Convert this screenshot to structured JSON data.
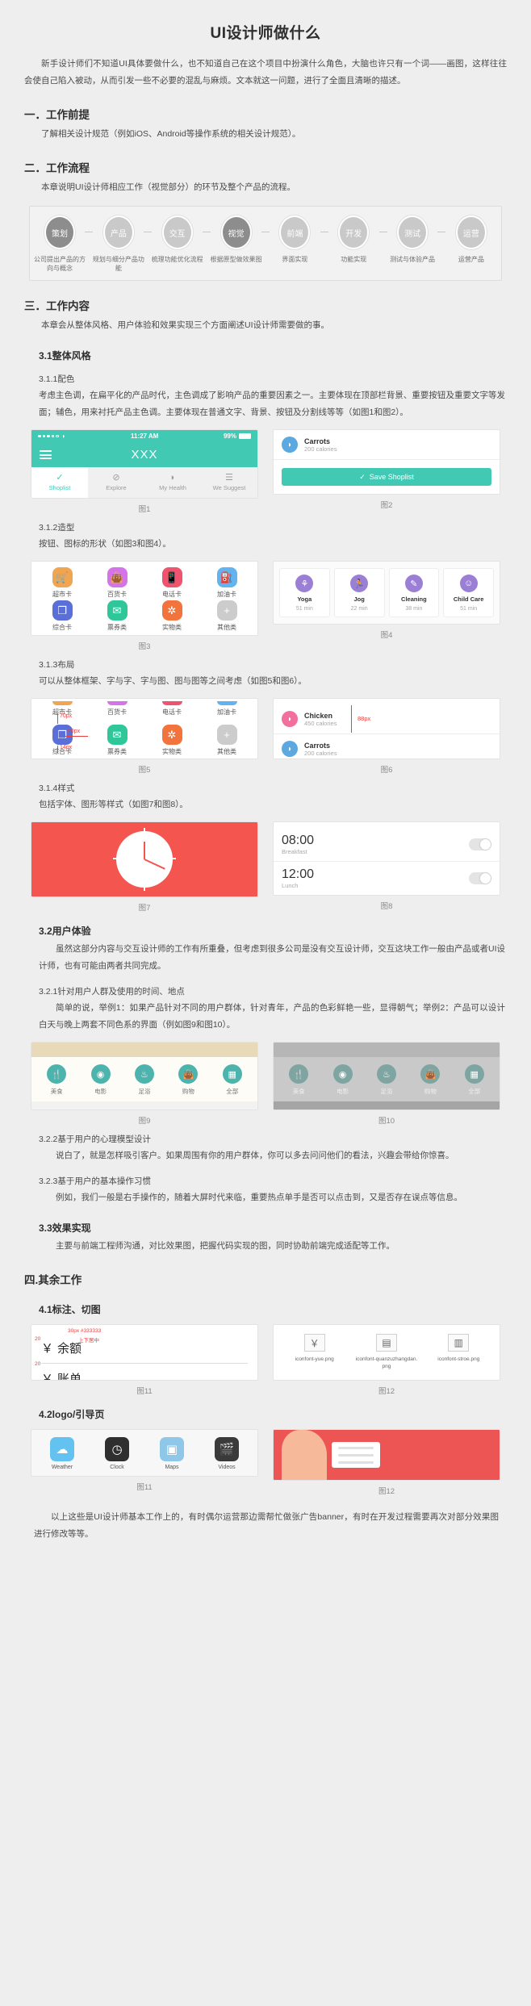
{
  "doc": {
    "title": "UI设计师做什么",
    "intro": "新手设计师们不知道UI具体要做什么，也不知道自己在这个项目中扮演什么角色，大脑也许只有一个词——画图，这样往往会使自己陷入被动，从而引发一些不必要的混乱与麻烦。文本就这一问题，进行了全面且清晰的描述。",
    "tail": "以上这些是UI设计师基本工作上的，有时偶尔运营那边需帮忙做张广告banner，有时在开发过程需要再次对部分效果图进行修改等等。"
  },
  "sections": {
    "s1": {
      "heading": "一．工作前提",
      "body": "了解相关设计规范（例如iOS、Android等操作系统的相关设计规范）。"
    },
    "s2": {
      "heading": "二．工作流程",
      "body": "本章说明UI设计师相应工作（视觉部分）的环节及整个产品的流程。"
    },
    "s3": {
      "heading": "三．工作内容",
      "body": "本章会从整体风格、用户体验和效果实现三个方面阐述UI设计师需要做的事。",
      "s31": {
        "heading": "3.1整体风格",
        "s311": {
          "heading": "3.1.1配色",
          "body": "考虑主色调，在扁平化的产品时代，主色调成了影响产品的重要因素之一。主要体现在顶部栏背景、重要按钮及重要文字等发面；辅色，用来衬托产品主色调。主要体现在普通文字、背景、按钮及分割线等等（如图1和图2）。"
        },
        "s312": {
          "heading": "3.1.2造型",
          "body": "按钮、图标的形状（如图3和图4）。"
        },
        "s313": {
          "heading": "3.1.3布局",
          "body": "可以从整体框架、字与字、字与图、图与图等之间考虑（如图5和图6）。"
        },
        "s314": {
          "heading": "3.1.4样式",
          "body": "包括字体、图形等样式（如图7和图8）。"
        }
      },
      "s32": {
        "heading": "3.2用户体验",
        "body": "虽然这部分内容与交互设计师的工作有所重叠，但考虑到很多公司是没有交互设计师，交互这块工作一般由产品或者UI设计师，也有可能由两者共同完成。",
        "s321": {
          "heading": "3.2.1针对用户人群及使用的时间、地点",
          "body": "简单的说，举例1：如果产品针对不同的用户群体，针对青年，产品的色彩鲜艳一些，显得朝气；举例2：产品可以设计白天与晚上两套不同色系的界面（例如图9和图10）。"
        },
        "s322": {
          "heading": "3.2.2基于用户的心理模型设计",
          "body": "说白了，就是怎样吸引客户。如果周围有你的用户群体，你可以多去问问他们的看法，兴趣会带给你惊喜。"
        },
        "s323": {
          "heading": "3.2.3基于用户的基本操作习惯",
          "body": "例如，我们一般是右手操作的，随着大屏时代来临，重要热点单手是否可以点击到，又是否存在误点等信息。"
        }
      },
      "s33": {
        "heading": "3.3效果实现",
        "body": "主要与前端工程师沟通，对比效果图，把握代码实现的图，同时协助前端完成适配等工作。"
      }
    },
    "s4": {
      "heading": "四.其余工作",
      "s41": {
        "heading": "4.1标注、切图"
      },
      "s42": {
        "heading": "4.2logo/引导页"
      }
    }
  },
  "flow": {
    "nodes": [
      {
        "title": "策划",
        "desc": "公司提出产品的方向与概念",
        "active": false
      },
      {
        "title": "产品",
        "desc": "规划与细分产品功能",
        "active": false
      },
      {
        "title": "交互",
        "desc": "梳理功能优化流程",
        "active": false
      },
      {
        "title": "视觉",
        "desc": "根据原型做效果图",
        "active": true
      },
      {
        "title": "前端",
        "desc": "界面实现",
        "active": false
      },
      {
        "title": "开发",
        "desc": "功能实现",
        "active": false
      },
      {
        "title": "测试",
        "desc": "测试与体验产品",
        "active": false
      },
      {
        "title": "运营",
        "desc": "运营产品",
        "active": false
      }
    ]
  },
  "captions": {
    "f1": "图1",
    "f2": "图2",
    "f3": "图3",
    "f4": "图4",
    "f5": "图5",
    "f6": "图6",
    "f7": "图7",
    "f8": "图8",
    "f9": "图9",
    "f10": "图10",
    "f11": "图11",
    "f12": "图12",
    "f11b": "图11",
    "f12b": "图12"
  },
  "fig1": {
    "status_time": "11:27 AM",
    "status_battery": "99%",
    "nav_title": "XXX",
    "tabs": [
      {
        "label": "Shoplist",
        "icon": "check-icon",
        "glyph": "✓",
        "active": true
      },
      {
        "label": "Explore",
        "icon": "compass-icon",
        "glyph": "⊘",
        "active": false
      },
      {
        "label": "My Health",
        "icon": "leaf-icon",
        "glyph": "◗",
        "active": false
      },
      {
        "label": "We Suggest",
        "icon": "list-icon",
        "glyph": "☰",
        "active": false
      }
    ],
    "accent": "#41c9b4"
  },
  "fig2": {
    "item_name": "Carrots",
    "item_calories": "200 calories",
    "button_label": "Save Shoplist",
    "button_glyph": "✓",
    "accent": "#41c9b4"
  },
  "fig3": {
    "icons": [
      {
        "label": "超市卡",
        "glyph": "🛒",
        "color": "o"
      },
      {
        "label": "百货卡",
        "glyph": "👜",
        "color": "m"
      },
      {
        "label": "电话卡",
        "glyph": "📱",
        "color": "r"
      },
      {
        "label": "加油卡",
        "glyph": "⛽",
        "color": "b"
      },
      {
        "label": "综合卡",
        "glyph": "❐",
        "color": "pu"
      },
      {
        "label": "票券类",
        "glyph": "✉",
        "color": "g"
      },
      {
        "label": "实物类",
        "glyph": "✲",
        "color": "or2"
      },
      {
        "label": "其他类",
        "glyph": "+",
        "color": "gy"
      }
    ]
  },
  "fig4": {
    "cards": [
      {
        "title": "Yoga",
        "sub": "51 min",
        "glyph": "⚘"
      },
      {
        "title": "Jog",
        "sub": "22 min",
        "glyph": "🏃"
      },
      {
        "title": "Cleaning",
        "sub": "38 min",
        "glyph": "✎"
      },
      {
        "title": "Child Care",
        "sub": "51 min",
        "glyph": "☺"
      }
    ],
    "accent": "#9b7fd4"
  },
  "fig5": {
    "row1": [
      "超市卡",
      "百货卡",
      "电话卡",
      "加油卡"
    ],
    "row2": [
      "综合卡",
      "票券类",
      "实物类",
      "其他类"
    ],
    "annotations": [
      "70px",
      "60px",
      "14px"
    ],
    "anno_color": "#e8413f"
  },
  "fig6": {
    "rows": [
      {
        "name": "Chicken",
        "cal": "450 calories",
        "color": "pink"
      },
      {
        "name": "Carrots",
        "cal": "200 calories",
        "color": "blue"
      }
    ],
    "measure": "88px",
    "anno_color": "#e8413f"
  },
  "fig7": {
    "bg": "#f4564f"
  },
  "fig8": {
    "rows": [
      {
        "time": "08:00",
        "label": "Breakfast",
        "on": false
      },
      {
        "time": "12:00",
        "label": "Lunch",
        "on": false
      }
    ]
  },
  "fig9": {
    "items": [
      {
        "label": "美食",
        "glyph": "🍴"
      },
      {
        "label": "电影",
        "glyph": "◉"
      },
      {
        "label": "足浴",
        "glyph": "♨"
      },
      {
        "label": "购物",
        "glyph": "👜"
      },
      {
        "label": "全部",
        "glyph": "▦"
      }
    ],
    "theme": "light"
  },
  "fig10": {
    "items": [
      {
        "label": "美食",
        "glyph": "🍴"
      },
      {
        "label": "电影",
        "glyph": "◉"
      },
      {
        "label": "足浴",
        "glyph": "♨"
      },
      {
        "label": "购物",
        "glyph": "👜"
      },
      {
        "label": "全部",
        "glyph": "▦"
      }
    ],
    "theme": "dark"
  },
  "fig11": {
    "line1": "余额",
    "line2": "账单",
    "symbol": "￥",
    "notes": [
      "30px #333333",
      "上下居中",
      "20"
    ],
    "anno_color": "#e8413f"
  },
  "fig12": {
    "assets": [
      {
        "name": "iconfont-yue.png",
        "glyph": "￥"
      },
      {
        "name": "iconfont-quanzuzhangdan.png",
        "glyph": "▤"
      },
      {
        "name": "iconfont-stroe.png",
        "glyph": "▥"
      }
    ]
  },
  "fig11b": {
    "apps": [
      {
        "label": "Weather",
        "glyph": "☁",
        "color": "#63c2f0"
      },
      {
        "label": "Clock",
        "glyph": "◷",
        "color": "#2f2f2f"
      },
      {
        "label": "Maps",
        "glyph": "▣",
        "color": "#8ec7e8"
      },
      {
        "label": "Videos",
        "glyph": "🎬",
        "color": "#3a3a3a"
      }
    ]
  },
  "fig12b": {
    "bg": "#ed5454"
  }
}
